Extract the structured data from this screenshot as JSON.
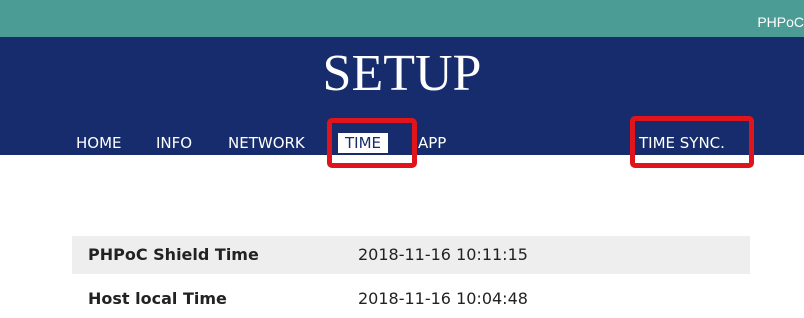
{
  "brand": "PHPoC",
  "header": {
    "title": "SETUP"
  },
  "nav": {
    "items": [
      {
        "label": "HOME"
      },
      {
        "label": "INFO"
      },
      {
        "label": "NETWORK"
      },
      {
        "label": "TIME",
        "active": true
      },
      {
        "label": "APP"
      }
    ],
    "time_sync_label": "TIME SYNC."
  },
  "time_table": {
    "rows": [
      {
        "label": "PHPoC Shield Time",
        "value": "2018-11-16 10:11:15"
      },
      {
        "label": "Host local Time",
        "value": "2018-11-16 10:04:48"
      }
    ]
  },
  "colors": {
    "brand_bar": "#4a9c94",
    "header_bg": "#162c6c",
    "highlight_border": "#e0141b",
    "row_shade": "#eeeeee"
  }
}
